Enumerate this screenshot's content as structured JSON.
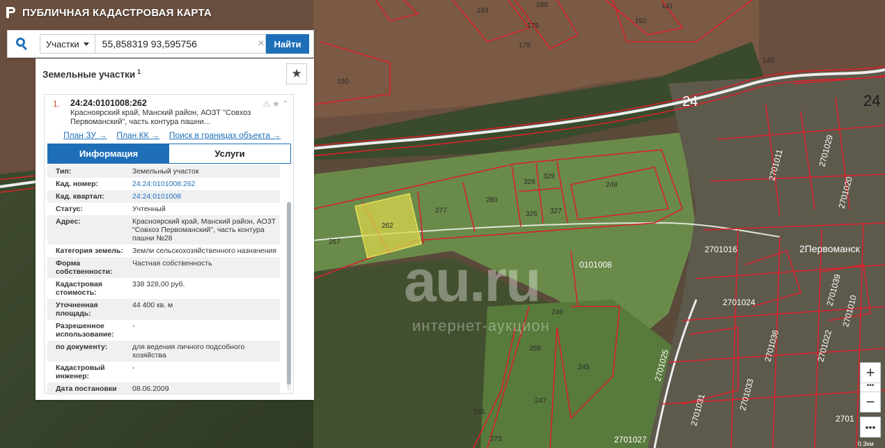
{
  "app": {
    "title": "ПУБЛИЧНАЯ КАДАСТРОВАЯ КАРТА"
  },
  "search": {
    "type_label": "Участки",
    "query": "55,858319 93,595756",
    "clear_glyph": "×",
    "find_label": "Найти"
  },
  "results": {
    "title": "Земельные участки",
    "count": "1",
    "favorite_glyph": "★",
    "item": {
      "index": "1.",
      "cad_number": "24:24:0101008:262",
      "address_short": "Красноярский край, Манский район, АОЗТ \"Совхоз Первоманский\", часть контура пашни...",
      "links": [
        "План ЗУ →",
        "План КК →",
        "Поиск в границах объекта →"
      ],
      "tools": [
        "⚠",
        "★",
        "⌃"
      ]
    },
    "tabs": {
      "info": "Информация",
      "services": "Услуги"
    },
    "rows": [
      {
        "k": "Тип:",
        "v": "Земельный участок"
      },
      {
        "k": "Кад. номер:",
        "v": "24:24:0101008:262"
      },
      {
        "k": "Кад. квартал:",
        "v": "24:24:0101008"
      },
      {
        "k": "Статус:",
        "v": "Учтенный"
      },
      {
        "k": "Адрес:",
        "v": "Красноярский край, Манский район, АОЗТ \"Совхоз Первоманский\", часть контура пашни №28"
      },
      {
        "k": "Категория земель:",
        "v": "Земли сельскохозяйственного назначения"
      },
      {
        "k": "Форма собственности:",
        "v": "Частная собственность"
      },
      {
        "k": "Кадастровая стоимость:",
        "v": "338 328,00 руб."
      },
      {
        "k": "Уточненная площадь:",
        "v": "44 400 кв. м"
      },
      {
        "k": "Разрешенное использование:",
        "v": "-"
      },
      {
        "k": "по документу:",
        "v": "для ведения личного подсобного хозяйства"
      },
      {
        "k": "Кадастровый инженер:",
        "v": "-"
      },
      {
        "k": "Дата постановки",
        "v": "08.06.2009"
      }
    ]
  },
  "map": {
    "labels": [
      "262",
      "277",
      "280",
      "326",
      "329",
      "327",
      "328",
      "248",
      "267",
      "246",
      "258",
      "245",
      "247",
      "261",
      "275",
      "190",
      "192",
      "183",
      "180",
      "179",
      "178",
      "141",
      "145",
      "0101008",
      "24",
      "2701016",
      "2701024",
      "2701011",
      "2701020",
      "2701025",
      "2701033",
      "2701031",
      "2701036",
      "2701029",
      "2701027",
      "2701022",
      "2701039",
      "2701010",
      "2Первоманск",
      "24",
      "2701"
    ],
    "colors": {
      "boundary": "#d8212b",
      "selected": "#e8e05a",
      "road": "#f2f2f2"
    }
  },
  "zoom": {
    "in": "+",
    "out": "−",
    "dots": "•••",
    "more": "•••"
  },
  "scale": "0.3км",
  "watermark": {
    "main": "au.ru",
    "sub": "интернет-аукцион"
  }
}
